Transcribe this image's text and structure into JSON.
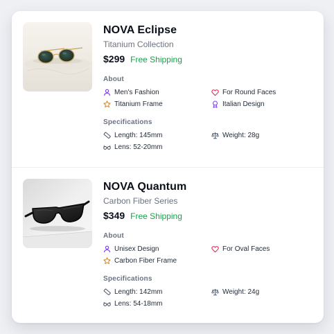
{
  "colors": {
    "page_bg": "#eef0f4",
    "card_bg": "#ffffff",
    "price_green": "#16a34a",
    "accent_purple": "#7c3aed",
    "accent_pink": "#e11d48",
    "accent_orange": "#d97706"
  },
  "products": [
    {
      "name": "NOVA Eclipse",
      "collection": "Titanium Collection",
      "price": "$299",
      "shipping": "Free Shipping",
      "about_title": "About",
      "about": [
        {
          "icon": "user-icon",
          "text": "Men's Fashion"
        },
        {
          "icon": "heart-icon",
          "text": "For Round Faces"
        },
        {
          "icon": "star-icon",
          "text": "Titanium Frame"
        },
        {
          "icon": "award-icon",
          "text": "Italian Design"
        }
      ],
      "specs_title": "Specifications",
      "specs": [
        {
          "icon": "ruler-icon",
          "text": "Length: 145mm"
        },
        {
          "icon": "scale-icon",
          "text": "Weight: 28g"
        },
        {
          "icon": "glasses-icon",
          "text": "Lens: 52-20mm"
        }
      ]
    },
    {
      "name": "NOVA Quantum",
      "collection": "Carbon Fiber Series",
      "price": "$349",
      "shipping": "Free Shipping",
      "about_title": "About",
      "about": [
        {
          "icon": "user-icon",
          "text": "Unisex Design"
        },
        {
          "icon": "heart-icon",
          "text": "For Oval Faces"
        },
        {
          "icon": "star-icon",
          "text": "Carbon Fiber Frame"
        }
      ],
      "specs_title": "Specifications",
      "specs": [
        {
          "icon": "ruler-icon",
          "text": "Length: 142mm"
        },
        {
          "icon": "scale-icon",
          "text": "Weight: 24g"
        },
        {
          "icon": "glasses-icon",
          "text": "Lens: 54-18mm"
        }
      ]
    }
  ]
}
